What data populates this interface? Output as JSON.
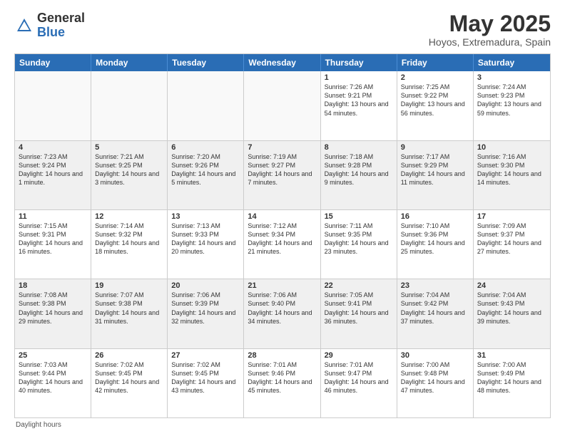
{
  "header": {
    "logo_general": "General",
    "logo_blue": "Blue",
    "month_title": "May 2025",
    "location": "Hoyos, Extremadura, Spain"
  },
  "days_of_week": [
    "Sunday",
    "Monday",
    "Tuesday",
    "Wednesday",
    "Thursday",
    "Friday",
    "Saturday"
  ],
  "weeks": [
    [
      {
        "day": "",
        "empty": true
      },
      {
        "day": "",
        "empty": true
      },
      {
        "day": "",
        "empty": true
      },
      {
        "day": "",
        "empty": true
      },
      {
        "day": "1",
        "sunrise": "7:26 AM",
        "sunset": "9:21 PM",
        "daylight": "13 hours and 54 minutes."
      },
      {
        "day": "2",
        "sunrise": "7:25 AM",
        "sunset": "9:22 PM",
        "daylight": "13 hours and 56 minutes."
      },
      {
        "day": "3",
        "sunrise": "7:24 AM",
        "sunset": "9:23 PM",
        "daylight": "13 hours and 59 minutes."
      }
    ],
    [
      {
        "day": "4",
        "sunrise": "7:23 AM",
        "sunset": "9:24 PM",
        "daylight": "14 hours and 1 minute."
      },
      {
        "day": "5",
        "sunrise": "7:21 AM",
        "sunset": "9:25 PM",
        "daylight": "14 hours and 3 minutes."
      },
      {
        "day": "6",
        "sunrise": "7:20 AM",
        "sunset": "9:26 PM",
        "daylight": "14 hours and 5 minutes."
      },
      {
        "day": "7",
        "sunrise": "7:19 AM",
        "sunset": "9:27 PM",
        "daylight": "14 hours and 7 minutes."
      },
      {
        "day": "8",
        "sunrise": "7:18 AM",
        "sunset": "9:28 PM",
        "daylight": "14 hours and 9 minutes."
      },
      {
        "day": "9",
        "sunrise": "7:17 AM",
        "sunset": "9:29 PM",
        "daylight": "14 hours and 11 minutes."
      },
      {
        "day": "10",
        "sunrise": "7:16 AM",
        "sunset": "9:30 PM",
        "daylight": "14 hours and 14 minutes."
      }
    ],
    [
      {
        "day": "11",
        "sunrise": "7:15 AM",
        "sunset": "9:31 PM",
        "daylight": "14 hours and 16 minutes."
      },
      {
        "day": "12",
        "sunrise": "7:14 AM",
        "sunset": "9:32 PM",
        "daylight": "14 hours and 18 minutes."
      },
      {
        "day": "13",
        "sunrise": "7:13 AM",
        "sunset": "9:33 PM",
        "daylight": "14 hours and 20 minutes."
      },
      {
        "day": "14",
        "sunrise": "7:12 AM",
        "sunset": "9:34 PM",
        "daylight": "14 hours and 21 minutes."
      },
      {
        "day": "15",
        "sunrise": "7:11 AM",
        "sunset": "9:35 PM",
        "daylight": "14 hours and 23 minutes."
      },
      {
        "day": "16",
        "sunrise": "7:10 AM",
        "sunset": "9:36 PM",
        "daylight": "14 hours and 25 minutes."
      },
      {
        "day": "17",
        "sunrise": "7:09 AM",
        "sunset": "9:37 PM",
        "daylight": "14 hours and 27 minutes."
      }
    ],
    [
      {
        "day": "18",
        "sunrise": "7:08 AM",
        "sunset": "9:38 PM",
        "daylight": "14 hours and 29 minutes."
      },
      {
        "day": "19",
        "sunrise": "7:07 AM",
        "sunset": "9:38 PM",
        "daylight": "14 hours and 31 minutes."
      },
      {
        "day": "20",
        "sunrise": "7:06 AM",
        "sunset": "9:39 PM",
        "daylight": "14 hours and 32 minutes."
      },
      {
        "day": "21",
        "sunrise": "7:06 AM",
        "sunset": "9:40 PM",
        "daylight": "14 hours and 34 minutes."
      },
      {
        "day": "22",
        "sunrise": "7:05 AM",
        "sunset": "9:41 PM",
        "daylight": "14 hours and 36 minutes."
      },
      {
        "day": "23",
        "sunrise": "7:04 AM",
        "sunset": "9:42 PM",
        "daylight": "14 hours and 37 minutes."
      },
      {
        "day": "24",
        "sunrise": "7:04 AM",
        "sunset": "9:43 PM",
        "daylight": "14 hours and 39 minutes."
      }
    ],
    [
      {
        "day": "25",
        "sunrise": "7:03 AM",
        "sunset": "9:44 PM",
        "daylight": "14 hours and 40 minutes."
      },
      {
        "day": "26",
        "sunrise": "7:02 AM",
        "sunset": "9:45 PM",
        "daylight": "14 hours and 42 minutes."
      },
      {
        "day": "27",
        "sunrise": "7:02 AM",
        "sunset": "9:45 PM",
        "daylight": "14 hours and 43 minutes."
      },
      {
        "day": "28",
        "sunrise": "7:01 AM",
        "sunset": "9:46 PM",
        "daylight": "14 hours and 45 minutes."
      },
      {
        "day": "29",
        "sunrise": "7:01 AM",
        "sunset": "9:47 PM",
        "daylight": "14 hours and 46 minutes."
      },
      {
        "day": "30",
        "sunrise": "7:00 AM",
        "sunset": "9:48 PM",
        "daylight": "14 hours and 47 minutes."
      },
      {
        "day": "31",
        "sunrise": "7:00 AM",
        "sunset": "9:49 PM",
        "daylight": "14 hours and 48 minutes."
      }
    ]
  ],
  "footer": "Daylight hours"
}
